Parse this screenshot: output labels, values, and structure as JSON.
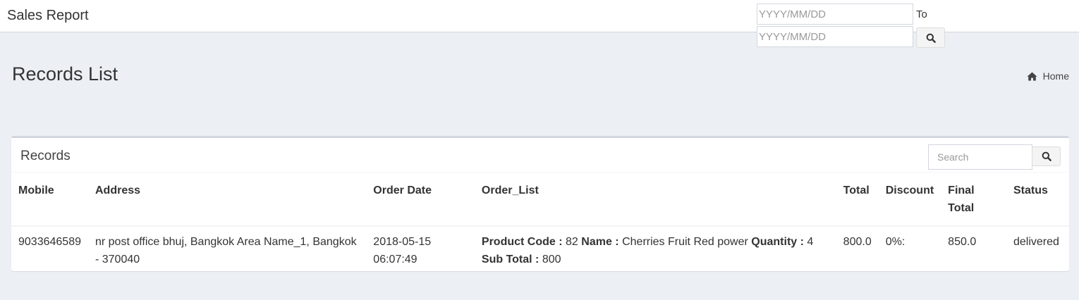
{
  "header": {
    "title": "Sales Report",
    "date_from_placeholder": "YYYY/MM/DD",
    "to_label": "To",
    "date_to_placeholder": "YYYY/MM/DD",
    "search_icon": "search-icon"
  },
  "page": {
    "title": "Records List",
    "breadcrumb": {
      "icon": "home-icon",
      "label": "Home"
    }
  },
  "panel": {
    "title": "Records",
    "search_placeholder": "Search",
    "table": {
      "columns": [
        "Mobile",
        "Address",
        "Order Date",
        "Order_List",
        "Total",
        "Discount",
        "Final Total",
        "Status"
      ],
      "rows": [
        {
          "mobile": "9033646589",
          "address": "nr post office bhuj, Bangkok Area Name_1, Bangkok - 370040",
          "order_date": "2018-05-15 06:07:49",
          "order_list": {
            "product_code_label": "Product Code :",
            "product_code": "82",
            "name_label": "Name :",
            "name": "Cherries Fruit Red power",
            "quantity_label": "Quantity :",
            "quantity": "4",
            "subtotal_label": "Sub Total :",
            "subtotal": "800"
          },
          "total": "800.0",
          "discount": "0%:",
          "final_total": "850.0",
          "status": "delivered"
        }
      ]
    }
  },
  "colors": {
    "background": "#ecf0f5",
    "panel_border": "#d2d6de",
    "text": "#333333"
  }
}
